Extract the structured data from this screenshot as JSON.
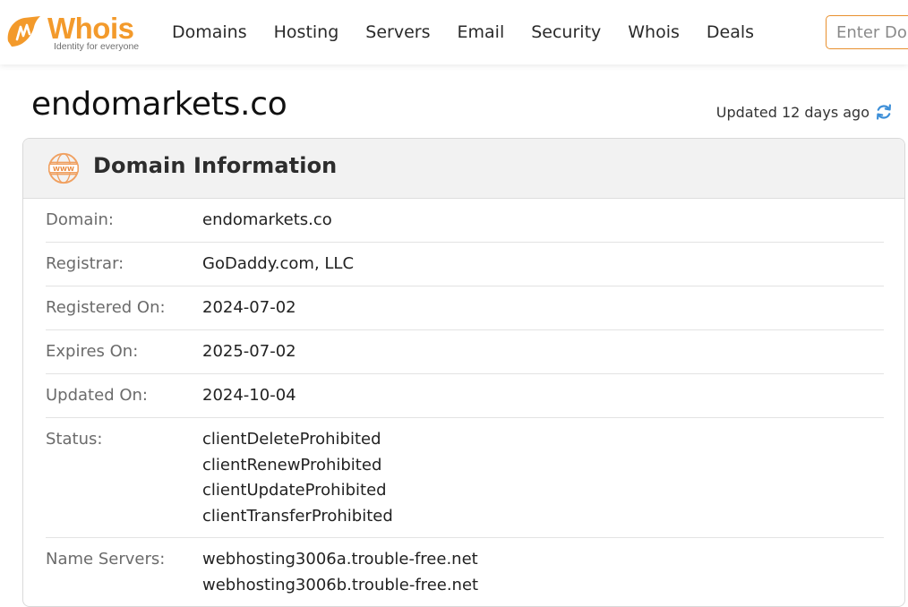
{
  "brand": {
    "name": "Whois",
    "tagline": "Identity for everyone",
    "color": "#f39a2b"
  },
  "nav": {
    "items": [
      {
        "label": "Domains"
      },
      {
        "label": "Hosting"
      },
      {
        "label": "Servers"
      },
      {
        "label": "Email"
      },
      {
        "label": "Security"
      },
      {
        "label": "Whois"
      },
      {
        "label": "Deals"
      }
    ]
  },
  "search": {
    "placeholder": "Enter Domain",
    "value": ""
  },
  "page": {
    "title": "endomarkets.co",
    "updated": "Updated 12 days ago",
    "refresh_icon": "refresh-icon"
  },
  "card": {
    "title": "Domain Information",
    "icon": "www-icon",
    "rows": [
      {
        "label": "Domain:",
        "values": [
          "endomarkets.co"
        ]
      },
      {
        "label": "Registrar:",
        "values": [
          "GoDaddy.com, LLC"
        ]
      },
      {
        "label": "Registered On:",
        "values": [
          "2024-07-02"
        ]
      },
      {
        "label": "Expires On:",
        "values": [
          "2025-07-02"
        ]
      },
      {
        "label": "Updated On:",
        "values": [
          "2024-10-04"
        ]
      },
      {
        "label": "Status:",
        "values": [
          "clientDeleteProhibited",
          "clientRenewProhibited",
          "clientUpdateProhibited",
          "clientTransferProhibited"
        ]
      },
      {
        "label": "Name Servers:",
        "values": [
          "webhosting3006a.trouble-free.net",
          "webhosting3006b.trouble-free.net"
        ]
      }
    ]
  }
}
